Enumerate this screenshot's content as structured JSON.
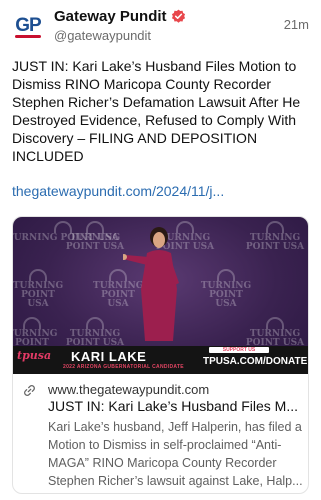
{
  "author": {
    "display_name": "Gateway Pundit",
    "handle": "@gatewaypundit",
    "avatar_text": "GP",
    "verified_icon": "verified-badge-icon",
    "verified_color": "#e8474c"
  },
  "post": {
    "timestamp": "21m",
    "text": "JUST IN: Kari Lake’s Husband Files Motion to Dismiss RINO Maricopa County Recorder Stephen Richer’s Defamation Lawsuit After He Destroyed Evidence, Refused to Comply With Discovery – FILING AND DEPOSITION INCLUDED",
    "link": "thegatewaypundit.com/2024/11/j...",
    "link_color": "#2b6cb0"
  },
  "card": {
    "image": {
      "background_logo_text": "TURNING POINT USA",
      "lower_third_name": "KARI LAKE",
      "lower_third_subtitle": "2022 ARIZONA GUBERNATORIAL CANDIDATE",
      "lower_third_support": "SUPPORT US",
      "lower_third_url": "TPUSA.COM/DONATE",
      "lower_third_logo": "tpusa"
    },
    "link_icon": "link-icon",
    "domain": "www.thegatewaypundit.com",
    "title": "JUST IN: Kari Lake’s Husband Files M...",
    "description": "Kari Lake’s husband, Jeff Halperin, has filed a Motion to Dismiss in self-proclaimed “Anti-MAGA” RINO Maricopa County Recorder Stephen Richer’s lawsuit against Lake, Halp..."
  }
}
